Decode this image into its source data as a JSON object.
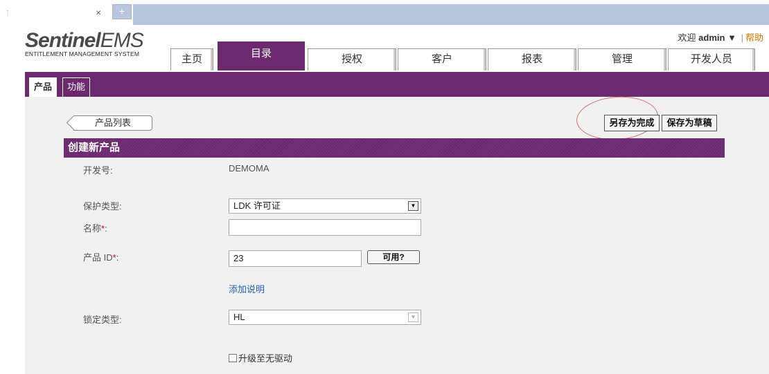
{
  "browser": {
    "close_glyph": "×",
    "newtab_glyph": "+"
  },
  "app": {
    "logo_main": "Sentinel",
    "logo_ems": "EMS",
    "logo_sub": "ENTITLEMENT MANAGEMENT SYSTEM"
  },
  "userbar": {
    "welcome": "欢迎",
    "username": "admin",
    "dropdown_glyph": "▼",
    "separator": "|",
    "help": "帮助"
  },
  "nav": {
    "tabs": [
      {
        "label": "主页"
      },
      {
        "label": "目录"
      },
      {
        "label": "授权"
      },
      {
        "label": "客户"
      },
      {
        "label": "报表"
      },
      {
        "label": "管理"
      },
      {
        "label": "开发人员"
      }
    ],
    "active_index": 1
  },
  "subnav": {
    "tabs": [
      {
        "label": "产品"
      },
      {
        "label": "功能"
      }
    ]
  },
  "toolbar": {
    "back_label": "产品列表",
    "save_complete_label": "另存为完成",
    "save_draft_label": "保存为草稿"
  },
  "form": {
    "section_title": "创建新产品",
    "developer_id": {
      "label": "开发号:",
      "value": "DEMOMA"
    },
    "protection_type": {
      "label": "保护类型:",
      "value": "LDK 许可证"
    },
    "name": {
      "label": "名称",
      "required_mark": "*",
      "colon": ":",
      "value": ""
    },
    "product_id": {
      "label": "产品 ID",
      "required_mark": "*",
      "colon": ":",
      "value": "23",
      "check_label": "可用?"
    },
    "add_description": "添加说明",
    "lock_type": {
      "label": "锁定类型:",
      "value": "HL"
    },
    "upgrade_checkbox": {
      "label": "升级至无驱动",
      "checked": false
    }
  },
  "colors": {
    "brand_purple": "#6a2a6d",
    "help_link": "#d47500",
    "link_blue": "#1f62b8",
    "highlight_circle": "#e06b6b"
  }
}
